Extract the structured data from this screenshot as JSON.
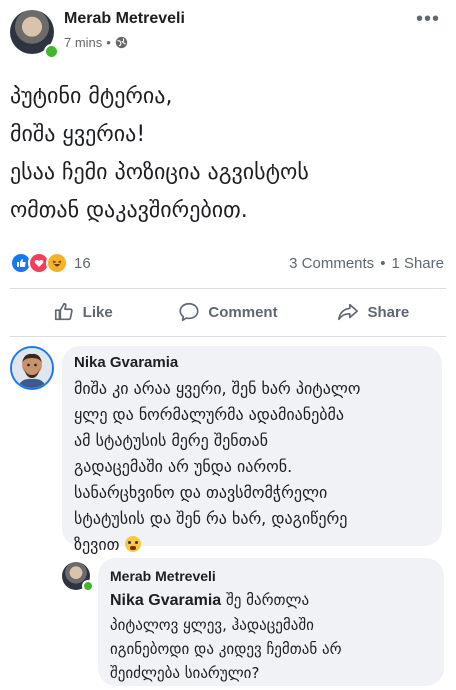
{
  "post": {
    "author": "Merab Metreveli",
    "time": "7 mins",
    "separator": "•",
    "privacy_icon": "globe-icon",
    "more_label": "•••",
    "text_lines": [
      "პუტინი მტერია,",
      "მიშა ყვერია!",
      "ესაა ჩემი პოზიცია აგვისტოს",
      "ომთან დაკავშირებით."
    ]
  },
  "reactions": {
    "icons": [
      "like-icon",
      "love-icon",
      "haha-icon"
    ],
    "count": "16",
    "comments": "3 Comments",
    "dot": "•",
    "shares": "1 Share"
  },
  "actions": {
    "like": "Like",
    "comment": "Comment",
    "share": "Share"
  },
  "comments": [
    {
      "author": "Nika Gvaramia",
      "lines": [
        "მიშა კი არაა ყვერი, შენ ხარ პიტალო",
        "ყლე და ნორმალურმა ადამიანებმა",
        "ამ სტატუსის მერე შენთან",
        "გადაცემაში არ უნდა იარონ.",
        "სანარცხვინო და თავსმომჭრელი",
        "სტატუსის და შენ რა ხარ, დაგიწერე",
        "ზევით"
      ],
      "emoji": "fearful-face-icon"
    },
    {
      "author": "Merab Metreveli",
      "mention": "Nika Gvaramia",
      "lines": [
        "შე მართლა",
        "პიტალოვ ყლევ, ჰადაცემაში",
        "იგინებოდი და კიდევ ჩემთან არ",
        "შეიძლება სიარული?"
      ]
    }
  ],
  "colors": {
    "brand": "#1877f2",
    "online": "#42b72a",
    "bubble": "#f0f2f5"
  }
}
